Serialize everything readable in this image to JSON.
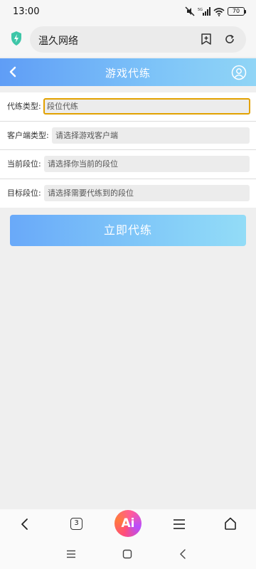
{
  "status_bar": {
    "time": "13:00",
    "battery": "70"
  },
  "browser": {
    "url_title": "温久网络",
    "tab_count": "3",
    "ai_label": "Ai"
  },
  "header": {
    "title": "游戏代练"
  },
  "form": {
    "rows": [
      {
        "label": "代练类型:",
        "value": "段位代练"
      },
      {
        "label": "客户端类型:",
        "value": "请选择游戏客户端"
      },
      {
        "label": "当前段位:",
        "value": "请选择你当前的段位"
      },
      {
        "label": "目标段位:",
        "value": "请选择需要代练到的段位"
      }
    ]
  },
  "submit_label": "立即代练",
  "colors": {
    "header_start": "#5f9df6",
    "header_end": "#90d5f6",
    "active_border": "#e2a100",
    "shield": "#3ec6a8"
  },
  "icons": {
    "status": [
      "no-sound-icon",
      "signal-5g-icon",
      "wifi-icon",
      "battery-icon"
    ],
    "browser_bar": [
      "shield-icon",
      "add-bookmark-icon",
      "refresh-icon"
    ],
    "header": [
      "back-arrow-icon",
      "user-icon"
    ],
    "browser_nav": [
      "back-icon",
      "tabs-icon",
      "ai-icon",
      "menu-icon",
      "home-icon"
    ],
    "system_nav": [
      "menu-icon",
      "home-square-icon",
      "back-icon"
    ]
  }
}
